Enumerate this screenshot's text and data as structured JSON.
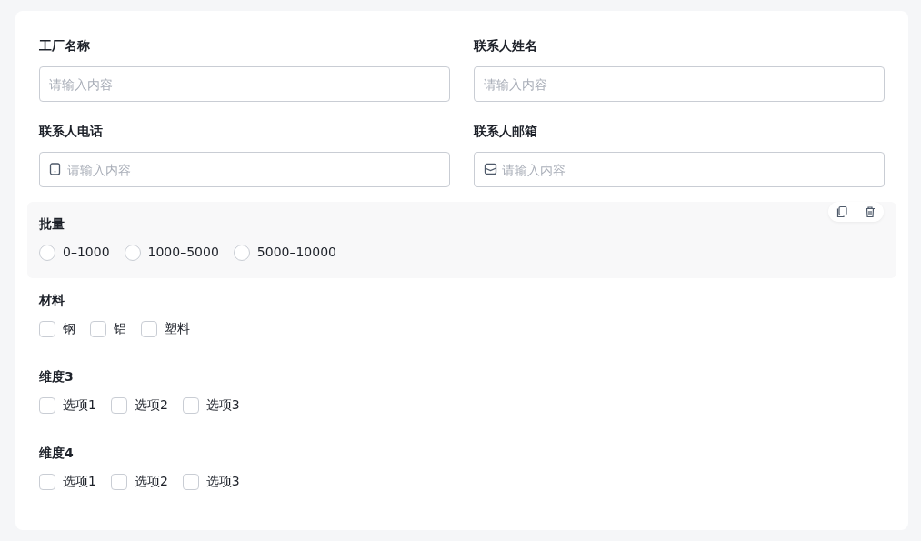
{
  "fields": [
    {
      "label": "工厂名称",
      "placeholder": "请输入内容",
      "kind": "plain"
    },
    {
      "label": "联系人姓名",
      "placeholder": "请输入内容",
      "kind": "plain"
    },
    {
      "label": "联系人电话",
      "placeholder": "请输入内容",
      "kind": "phone"
    },
    {
      "label": "联系人邮箱",
      "placeholder": "请输入内容",
      "kind": "mail"
    }
  ],
  "groups": [
    {
      "label": "批量",
      "kind": "radio",
      "active": true,
      "options": [
        {
          "label": "0–1000",
          "selected": false
        },
        {
          "label": "1000–5000",
          "selected": false
        },
        {
          "label": "5000–10000",
          "selected": false
        }
      ]
    },
    {
      "label": "材料",
      "kind": "checkbox",
      "active": false,
      "options": [
        {
          "label": "钢",
          "checked": false
        },
        {
          "label": "铝",
          "checked": false
        },
        {
          "label": "塑料",
          "checked": false
        }
      ]
    },
    {
      "label": "维度3",
      "kind": "checkbox",
      "active": false,
      "options": [
        {
          "label": "选项1",
          "checked": false
        },
        {
          "label": "选项2",
          "checked": false
        },
        {
          "label": "选项3",
          "checked": false
        }
      ]
    },
    {
      "label": "维度4",
      "kind": "checkbox",
      "active": false,
      "options": [
        {
          "label": "选项1",
          "checked": false
        },
        {
          "label": "选项2",
          "checked": false
        },
        {
          "label": "选项3",
          "checked": false
        }
      ]
    }
  ]
}
